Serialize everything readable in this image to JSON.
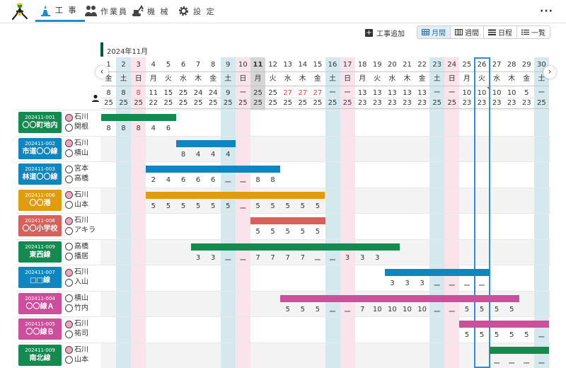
{
  "nav": {
    "items": [
      {
        "name": "nav-projects",
        "icon": "traffic-cone-icon",
        "label": "工 事",
        "active": true
      },
      {
        "name": "nav-workers",
        "icon": "people-icon",
        "label": "作業員",
        "active": false
      },
      {
        "name": "nav-machines",
        "icon": "excavator-icon",
        "label": "機 械",
        "active": false
      },
      {
        "name": "nav-settings",
        "icon": "gear-icon",
        "label": "設 定",
        "active": false
      }
    ],
    "more": "···"
  },
  "toolbar": {
    "add_label": "工事追加",
    "views": [
      {
        "name": "view-month",
        "icon": "month-grid-icon",
        "label": "月間",
        "active": true
      },
      {
        "name": "view-week",
        "icon": "week-grid-icon",
        "label": "週間",
        "active": false
      },
      {
        "name": "view-day",
        "icon": "schedule-icon",
        "label": "日程",
        "active": false
      },
      {
        "name": "view-list",
        "icon": "list-icon",
        "label": "一覧",
        "active": false
      }
    ]
  },
  "calendar": {
    "month_label": "2024年11月",
    "dates": [
      "1",
      "2",
      "3",
      "4",
      "5",
      "6",
      "7",
      "8",
      "9",
      "10",
      "11",
      "12",
      "13",
      "14",
      "15",
      "16",
      "17",
      "18",
      "19",
      "20",
      "21",
      "22",
      "23",
      "24",
      "25",
      "26",
      "27",
      "28",
      "29",
      "30"
    ],
    "weekdays": [
      "金",
      "土",
      "日",
      "月",
      "火",
      "水",
      "木",
      "金",
      "土",
      "日",
      "月",
      "火",
      "水",
      "木",
      "金",
      "土",
      "日",
      "月",
      "火",
      "水",
      "木",
      "金",
      "土",
      "日",
      "月",
      "火",
      "水",
      "木",
      "金",
      "土"
    ],
    "assigned": [
      "8",
      "8",
      "8",
      "11",
      "15",
      "25",
      "24",
      "24",
      "9",
      "ー",
      "25",
      "25",
      "27",
      "27",
      "27",
      "ー",
      "ー",
      "13",
      "13",
      "13",
      "13",
      "13",
      "ー",
      "ー",
      "10",
      "10",
      "10",
      "10",
      "5",
      "ー"
    ],
    "capacity": [
      "25",
      "25",
      "25",
      "22",
      "25",
      "25",
      "25",
      "25",
      "25",
      "25",
      "25",
      "25",
      "25",
      "25",
      "25",
      "25",
      "25",
      "23",
      "23",
      "23",
      "23",
      "23",
      "25",
      "25",
      "23",
      "23",
      "23",
      "23",
      "23",
      "25"
    ],
    "assigned_red_indices": [
      2,
      12,
      13,
      14
    ],
    "today_index": 25,
    "grey_index": 10,
    "sat_color": "#d4e9ee",
    "sun_color": "#fbe3ec",
    "grey_color": "#d6d6d6"
  },
  "projects": [
    {
      "code": "202411-001",
      "name": "〇〇町地内",
      "color": "#148a50",
      "people": [
        {
          "name": "石川",
          "avatar": "#f2a5c3"
        },
        {
          "name": "関根",
          "avatar": "#ffffff"
        }
      ],
      "bars": [
        {
          "from": 1,
          "to": 5,
          "color": "#148a50"
        }
      ],
      "values": [
        "8",
        "8",
        "8",
        "4",
        "6"
      ],
      "start": 1
    },
    {
      "code": "202411-002",
      "name": "市道〇〇線",
      "color": "#0f86c0",
      "people": [
        {
          "name": "石川",
          "avatar": "#f2a5c3"
        },
        {
          "name": "横山",
          "avatar": "#ffffff"
        }
      ],
      "bars": [
        {
          "from": 6,
          "to": 9,
          "color": "#0f86c0"
        }
      ],
      "values": [
        "8",
        "4",
        "4",
        "4"
      ],
      "start": 6
    },
    {
      "code": "202411-003",
      "name": "林道〇〇線",
      "color": "#0f86c0",
      "people": [
        {
          "name": "宮本",
          "avatar": "#ffffff"
        },
        {
          "name": "高橋",
          "avatar": "#ffffff"
        }
      ],
      "bars": [
        {
          "from": 4,
          "to": 12,
          "color": "#0f86c0"
        }
      ],
      "values": [
        "2",
        "4",
        "6",
        "6",
        "6",
        "ー",
        "ー",
        "8",
        "8"
      ],
      "start": 4
    },
    {
      "code": "202411-006",
      "name": "〇〇港",
      "color": "#e09c0c",
      "people": [
        {
          "name": "石川",
          "avatar": "#f2a5c3"
        },
        {
          "name": "山本",
          "avatar": "#ffffff"
        }
      ],
      "bars": [
        {
          "from": 4,
          "to": 15,
          "color": "#e09c0c"
        }
      ],
      "values": [
        "5",
        "5",
        "5",
        "5",
        "5",
        "5",
        "ー",
        "5",
        "5",
        "5",
        "5",
        "5"
      ],
      "start": 4
    },
    {
      "code": "202411-008",
      "name": "〇〇小学校",
      "color": "#d8605a",
      "people": [
        {
          "name": "石川",
          "avatar": "#f2a5c3"
        },
        {
          "name": "アキラ",
          "avatar": "#ffffff"
        }
      ],
      "bars": [
        {
          "from": 11,
          "to": 15,
          "color": "#d8605a"
        }
      ],
      "values": [
        "5",
        "5",
        "5",
        "5",
        "5"
      ],
      "start": 11
    },
    {
      "code": "202411-009",
      "name": "東西線",
      "color": "#148a50",
      "people": [
        {
          "name": "高橋",
          "avatar": "#ffffff"
        },
        {
          "name": "播居",
          "avatar": "#ffffff"
        }
      ],
      "bars": [
        {
          "from": 7,
          "to": 20,
          "color": "#148a50"
        }
      ],
      "values": [
        "3",
        "3",
        "ー",
        "ー",
        "7",
        "7",
        "7",
        "7",
        "ー",
        "ー",
        "3",
        "3",
        "3"
      ],
      "start": 7
    },
    {
      "code": "202411-007",
      "name": "□□線",
      "color": "#0f86c0",
      "people": [
        {
          "name": "石川",
          "avatar": "#f2a5c3"
        },
        {
          "name": "入山",
          "avatar": "#ffffff"
        }
      ],
      "bars": [
        {
          "from": 20,
          "to": 26,
          "color": "#0f86c0"
        }
      ],
      "values": [
        "3",
        "3",
        "3",
        "ー",
        "ー",
        "ー",
        "ー"
      ],
      "start": 20
    },
    {
      "code": "202411-004",
      "name": "〇〇線Ａ",
      "color": "#cb4f9b",
      "people": [
        {
          "name": "横山",
          "avatar": "#ffffff"
        },
        {
          "name": "竹内",
          "avatar": "#ffffff"
        }
      ],
      "bars": [
        {
          "from": 13,
          "to": 28,
          "color": "#cb4f9b"
        }
      ],
      "values": [
        "5",
        "5",
        "5",
        "ー",
        "ー",
        "7",
        "10",
        "10",
        "10",
        "10",
        "ー",
        "ー",
        "5",
        "5",
        "5",
        "5"
      ],
      "start": 13
    },
    {
      "code": "202411-005",
      "name": "〇〇線Ｂ",
      "color": "#cb4f9b",
      "people": [
        {
          "name": "石川",
          "avatar": "#f2a5c3"
        },
        {
          "name": "祐司",
          "avatar": "#ffffff"
        }
      ],
      "bars": [
        {
          "from": 25,
          "to": 30,
          "color": "#cb4f9b"
        }
      ],
      "values": [
        "5",
        "5",
        "5",
        "5",
        "5",
        "ー"
      ],
      "start": 25
    },
    {
      "code": "202411-009",
      "name": "南北線",
      "color": "#148a50",
      "people": [
        {
          "name": "石川",
          "avatar": "#f2a5c3"
        },
        {
          "name": "山本",
          "avatar": "#ffffff"
        }
      ],
      "bars": [
        {
          "from": 27,
          "to": 30,
          "color": "#148a50"
        }
      ],
      "values": [
        "ー",
        "ー",
        "ー",
        "ー"
      ],
      "start": 27
    }
  ]
}
